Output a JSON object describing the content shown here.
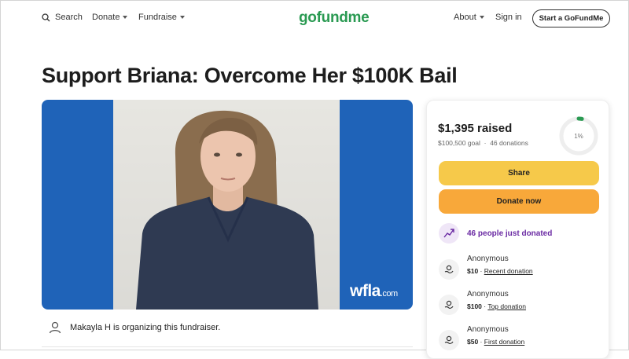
{
  "header": {
    "search_label": "Search",
    "donate_label": "Donate",
    "fundraise_label": "Fundraise",
    "logo_text": "gofundme",
    "about_label": "About",
    "signin_label": "Sign in",
    "start_label": "Start a GoFundMe"
  },
  "campaign": {
    "title": "Support Briana: Overcome Her $100K Bail",
    "image_watermark_main": "wfla",
    "image_watermark_sub": ".com",
    "organizer_text": "Makayla H is organizing this fundraiser."
  },
  "donation_panel": {
    "raised": "$1,395 raised",
    "goal": "$100,500 goal",
    "donations_count": "46 donations",
    "progress_label": "1%",
    "progress_fraction": 0.014,
    "share_label": "Share",
    "donate_label": "Donate now",
    "recent_activity": "46 people just donated",
    "donors": [
      {
        "name": "Anonymous",
        "amount": "$10",
        "tag": "Recent donation"
      },
      {
        "name": "Anonymous",
        "amount": "$100",
        "tag": "Top donation"
      },
      {
        "name": "Anonymous",
        "amount": "$50",
        "tag": "First donation"
      }
    ]
  },
  "colors": {
    "brand_green": "#2a9a52",
    "share_yellow": "#f6c94a",
    "donate_orange": "#f8a83a",
    "activity_purple": "#6a2aa3"
  },
  "icons": [
    "search-icon",
    "chevron-down-icon",
    "user-icon",
    "trending-up-icon",
    "donation-hand-icon"
  ]
}
